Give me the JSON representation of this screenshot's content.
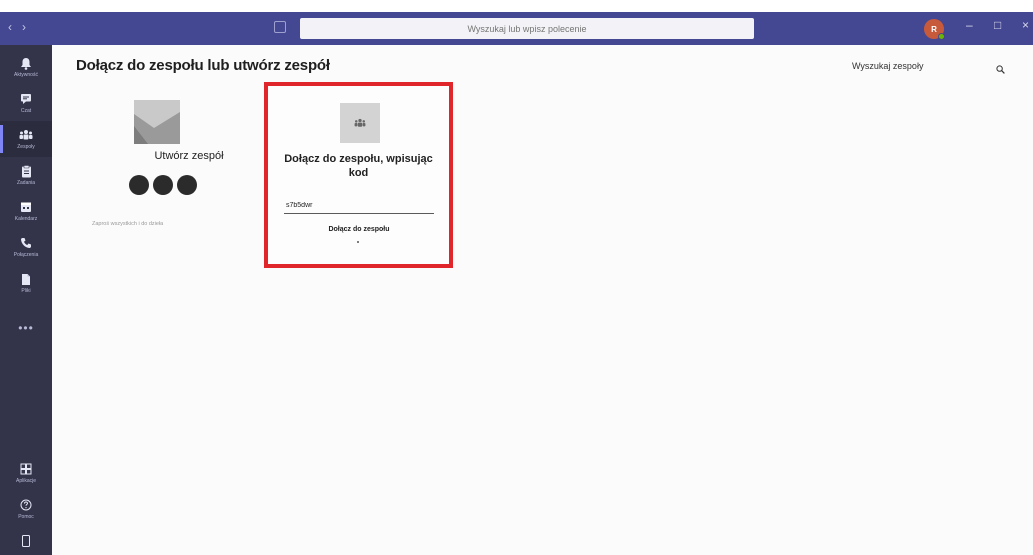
{
  "window": {
    "search_placeholder": "Wyszukaj lub wpisz polecenie",
    "avatar_initials": "R",
    "win_minimize": "–",
    "win_maximize": "□",
    "win_close": "×",
    "nav_back": "‹",
    "nav_forward": "›"
  },
  "rail": {
    "items": [
      {
        "label": "Aktywność",
        "icon": "bell-icon"
      },
      {
        "label": "Czat",
        "icon": "chat-icon"
      },
      {
        "label": "Zespoły",
        "icon": "teams-icon"
      },
      {
        "label": "Zadania",
        "icon": "assignments-icon"
      },
      {
        "label": "Kalendarz",
        "icon": "calendar-icon"
      },
      {
        "label": "Połączenia",
        "icon": "phone-icon"
      },
      {
        "label": "Pliki",
        "icon": "files-icon"
      }
    ],
    "more": "•••",
    "apps_label": "Aplikacje",
    "help_label": "Pomoc"
  },
  "main": {
    "title": "Dołącz do zespołu lub utwórz zespół",
    "search_teams": "Wyszukaj zespoły"
  },
  "create_card": {
    "title": "Utwórz zespół",
    "subtitle": "Zaproś wszystkich i do dzieła"
  },
  "join_card": {
    "title_line1": "Dołącz do zespołu, wpisując",
    "title_line2": "kod",
    "code_value": "s7b5dwr",
    "join_button": "Dołącz do zespołu"
  },
  "colors": {
    "titlebar": "#444791",
    "rail": "#33344a",
    "highlight_border": "#e0262a"
  }
}
